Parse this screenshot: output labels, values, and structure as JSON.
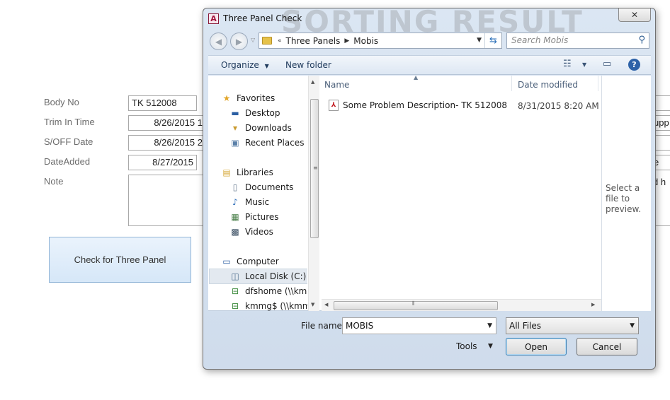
{
  "form": {
    "fields": [
      {
        "label": "Body No",
        "value": "TK 512008"
      },
      {
        "label": "Trim In Time",
        "value": "8/26/2015 1"
      },
      {
        "label": "S/OFF Date",
        "value": "8/26/2015 2"
      },
      {
        "label": "DateAdded",
        "value": "8/27/2015"
      },
      {
        "label": "Note",
        "value": ""
      }
    ],
    "check_button": "Check for Three Panel",
    "right_fragments": [
      "upp",
      "e",
      "d h"
    ]
  },
  "dialog": {
    "title": "Three Panel Check",
    "watermark": "SORTING RESULT",
    "close_glyph": "✕",
    "address": {
      "prefix": "«",
      "parts": [
        "Three Panels",
        "Mobis"
      ]
    },
    "search_placeholder": "Search Mobis",
    "toolbar": {
      "organize": "Organize",
      "new_folder": "New folder"
    },
    "nav": {
      "favorites": "Favorites",
      "desktop": "Desktop",
      "downloads": "Downloads",
      "recent_places": "Recent Places",
      "libraries": "Libraries",
      "documents": "Documents",
      "music": "Music",
      "pictures": "Pictures",
      "videos": "Videos",
      "computer": "Computer",
      "local_disk": "Local Disk (C:)",
      "dfshome": "dfshome (\\\\kmm",
      "kmmg": "kmmg$ (\\\\kmmf"
    },
    "columns": {
      "name": "Name",
      "date_modified": "Date modified"
    },
    "files": [
      {
        "name": "Some Problem Description- TK 512008",
        "date": "8/31/2015 8:20 AM"
      }
    ],
    "preview_text": "Select a file to preview.",
    "file_name_label": "File name:",
    "file_name_value": "MOBIS",
    "file_type": "All Files",
    "tools_label": "Tools",
    "open_label": "Open",
    "cancel_label": "Cancel"
  }
}
